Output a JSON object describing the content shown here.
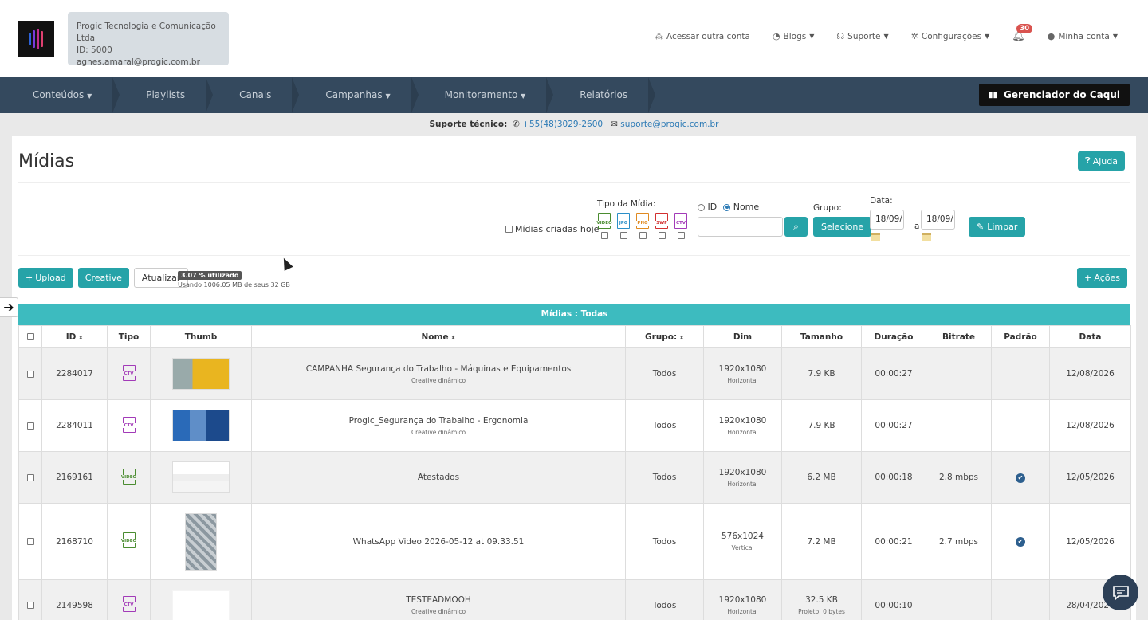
{
  "account": {
    "company": "Progic Tecnologia e Comunicação Ltda",
    "id": "ID: 5000",
    "email": "agnes.amaral@progic.com.br"
  },
  "topnav": {
    "acessar": "Acessar outra conta",
    "blogs": "Blogs",
    "suporte": "Suporte",
    "config": "Configurações",
    "notif_count": "30",
    "minha_conta": "Minha conta"
  },
  "mainnav": [
    "Conteúdos",
    "Playlists",
    "Canais",
    "Campanhas",
    "Monitoramento",
    "Relatórios"
  ],
  "gerente": "Gerenciador do Caqui",
  "support": {
    "label": "Suporte técnico:",
    "phone": "+55(48)3029-2600",
    "email": "suporte@progic.com.br"
  },
  "page": {
    "title": "Mídias",
    "ajuda": "Ajuda"
  },
  "filters": {
    "hoje": "Mídias criadas hoje",
    "tipo_label": "Tipo da Mídia:",
    "types": [
      "VIDEO",
      "JPG",
      "PNG",
      "SWF",
      "CTV"
    ],
    "radio_id": "ID",
    "radio_nome": "Nome",
    "grupo_label": "Grupo:",
    "grupo_btn": "Selecione",
    "data_label": "Data:",
    "date_from": "18/09/",
    "date_to": "18/09/",
    "a": "a",
    "limpar": "Limpar"
  },
  "toolbar": {
    "upload": "Upload",
    "creative": "Creative",
    "atualizar": "Atualizar",
    "usage_pill": "3.07 % utilizado",
    "usage_text": "Usando 1006.05 MB de seus 32 GB",
    "acoes": "Ações"
  },
  "table": {
    "title": "Mídias : Todas",
    "headers": [
      "ID",
      "Tipo",
      "Thumb",
      "Nome",
      "Grupo:",
      "Dim",
      "Tamanho",
      "Duração",
      "Bitrate",
      "Padrão",
      "Data"
    ],
    "rows": [
      {
        "id": "2284017",
        "type": "CTV",
        "name": "CAMPANHA Segurança do Trabalho - Máquinas e Equipamentos",
        "sub": "Creative dinâmico",
        "grupo": "Todos",
        "dim": "1920x1080",
        "orient": "Horizontal",
        "size": "7.9 KB",
        "size_sub": "",
        "dur": "00:00:27",
        "bitrate": "",
        "padrao": false,
        "date": "12/08/2026"
      },
      {
        "id": "2284011",
        "type": "CTV",
        "name": "Progic_Segurança do Trabalho - Ergonomia",
        "sub": "Creative dinâmico",
        "grupo": "Todos",
        "dim": "1920x1080",
        "orient": "Horizontal",
        "size": "7.9 KB",
        "size_sub": "",
        "dur": "00:00:27",
        "bitrate": "",
        "padrao": false,
        "date": "12/08/2026"
      },
      {
        "id": "2169161",
        "type": "VIDEO",
        "name": "Atestados",
        "sub": "",
        "grupo": "Todos",
        "dim": "1920x1080",
        "orient": "Horizontal",
        "size": "6.2 MB",
        "size_sub": "",
        "dur": "00:00:18",
        "bitrate": "2.8 mbps",
        "padrao": true,
        "date": "12/05/2026"
      },
      {
        "id": "2168710",
        "type": "VIDEO",
        "name": "WhatsApp Video 2026-05-12 at 09.33.51",
        "sub": "",
        "grupo": "Todos",
        "dim": "576x1024",
        "orient": "Vertical",
        "size": "7.2 MB",
        "size_sub": "",
        "dur": "00:00:21",
        "bitrate": "2.7 mbps",
        "padrao": true,
        "date": "12/05/2026"
      },
      {
        "id": "2149598",
        "type": "CTV",
        "name": "TESTEADMOOH",
        "sub": "Creative dinâmico",
        "grupo": "Todos",
        "dim": "1920x1080",
        "orient": "Horizontal",
        "size": "32.5 KB",
        "size_sub": "Projeto: 0 bytes",
        "dur": "00:00:10",
        "bitrate": "",
        "padrao": false,
        "date": "28/04/2026"
      }
    ]
  },
  "colors": {
    "teal": "#26a3a8",
    "nav": "#34495e",
    "table_head": "#3dbbbf"
  }
}
